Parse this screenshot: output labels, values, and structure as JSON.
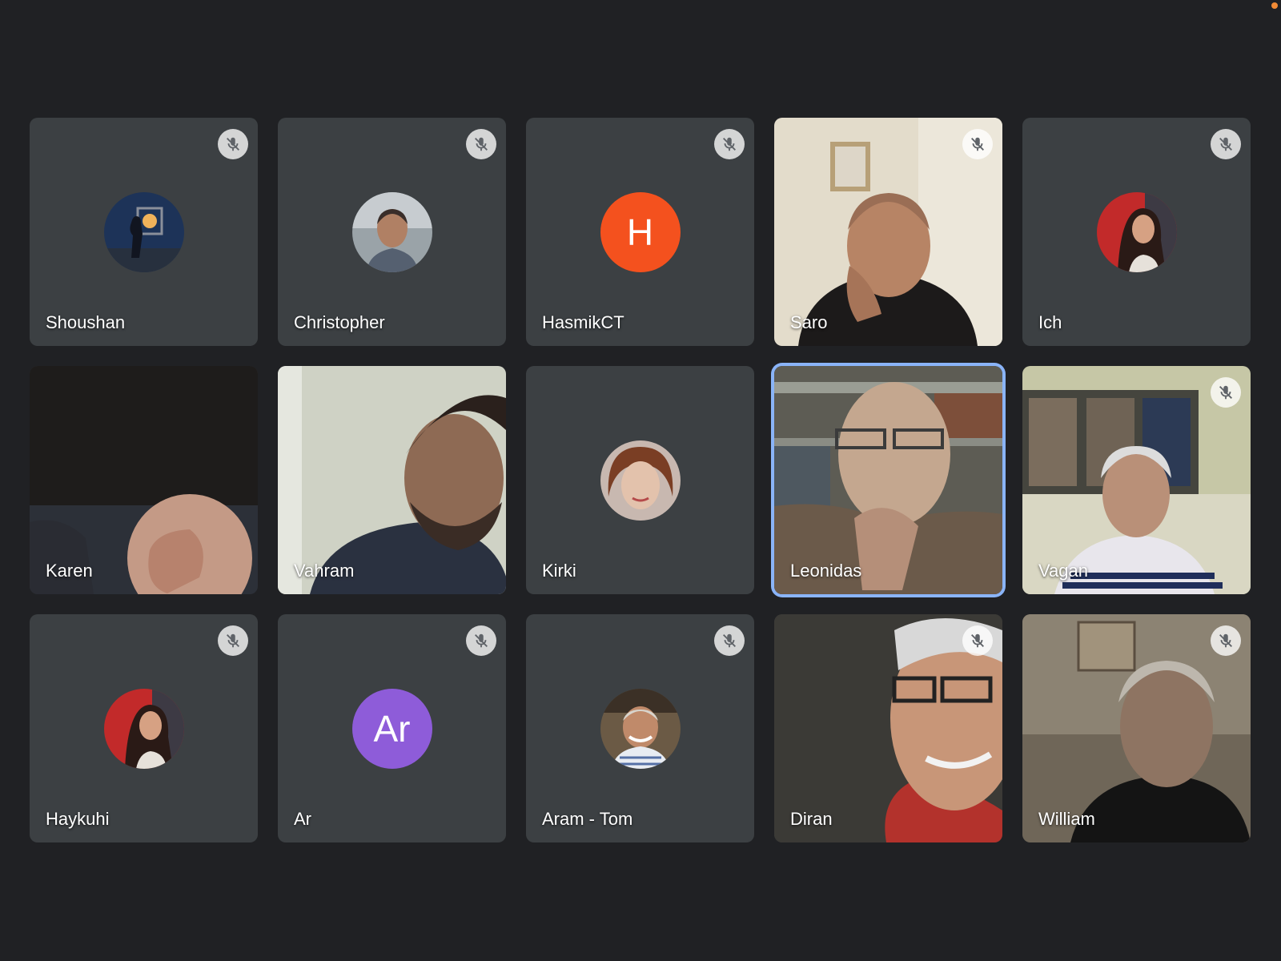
{
  "window": {
    "recording_indicator_color": "#f28b36"
  },
  "tile_background": "#3c4043",
  "active_highlight_color": "#8ab4f8",
  "participants": [
    {
      "name": "Shoushan",
      "muted": true,
      "display": "photo-avatar",
      "icon": "avatar-photo"
    },
    {
      "name": "Christopher",
      "muted": true,
      "display": "photo-avatar",
      "icon": "avatar-photo"
    },
    {
      "name": "HasmikCT",
      "muted": true,
      "display": "initial-avatar",
      "initial": "H",
      "avatar_color": "#f4511e"
    },
    {
      "name": "Saro",
      "muted": true,
      "display": "video"
    },
    {
      "name": "Ich",
      "muted": true,
      "display": "photo-avatar",
      "icon": "avatar-photo"
    },
    {
      "name": "Karen",
      "muted": false,
      "display": "video"
    },
    {
      "name": "Vahram",
      "muted": false,
      "display": "video"
    },
    {
      "name": "Kirki",
      "muted": false,
      "display": "photo-avatar",
      "icon": "avatar-photo"
    },
    {
      "name": "Leonidas",
      "muted": false,
      "display": "video",
      "active_speaker": true
    },
    {
      "name": "Vagan",
      "muted": true,
      "display": "video"
    },
    {
      "name": "Haykuhi",
      "muted": true,
      "display": "photo-avatar",
      "icon": "avatar-photo"
    },
    {
      "name": "Ar",
      "muted": true,
      "display": "initial-avatar",
      "initial": "Ar",
      "avatar_color": "#8e5cd9"
    },
    {
      "name": "Aram - Tom",
      "muted": true,
      "display": "photo-avatar",
      "icon": "avatar-photo"
    },
    {
      "name": "Diran",
      "muted": true,
      "display": "video"
    },
    {
      "name": "William",
      "muted": true,
      "display": "video"
    }
  ]
}
